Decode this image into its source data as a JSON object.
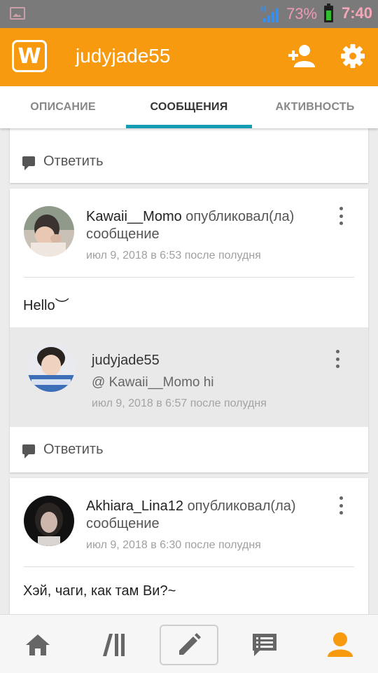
{
  "status_bar": {
    "network_type": "H",
    "battery_percent": "73%",
    "time": "7:40",
    "icons": [
      "image-notification-icon",
      "signal-icon",
      "battery-icon"
    ]
  },
  "app_bar": {
    "title": "judyjade55",
    "logo_glyph": "W",
    "icons": [
      "app-logo-icon",
      "add-friend-icon",
      "settings-gear-icon"
    ],
    "accent_color": "#f79a10"
  },
  "tabs": [
    {
      "label": "ОПИСАНИЕ",
      "active": false
    },
    {
      "label": "СООБЩЕНИЯ",
      "active": true
    },
    {
      "label": "АКТИВНОСТЬ",
      "active": false
    }
  ],
  "tab_indicator_color": "#139cb4",
  "feed": {
    "top_card": {
      "reply_label": "Ответить"
    },
    "post1": {
      "author": "Kawaii__Momo",
      "verb": "опубликовал(ла) сообщение",
      "date": "июл 9, 2018 в 6:53 после полудня",
      "body": "Hello︶",
      "comment": {
        "author": "judyjade55",
        "text": "@ Kawaii__Momo  hi",
        "date": "июл 9, 2018 в 6:57 после полудня"
      },
      "reply_label": "Ответить"
    },
    "post2": {
      "author": "Akhiara_Lina12",
      "verb": "опубликовал(ла) сообщение",
      "date": "июл 9, 2018 в 6:30 после полудня",
      "body": "Хэй, чаги, как там Ви?~"
    }
  },
  "bottom_nav": [
    {
      "icon": "home-icon",
      "active": false
    },
    {
      "icon": "library-icon",
      "active": false
    },
    {
      "icon": "write-pencil-icon",
      "active": false
    },
    {
      "icon": "messages-icon",
      "active": false
    },
    {
      "icon": "profile-icon",
      "active": true
    }
  ]
}
